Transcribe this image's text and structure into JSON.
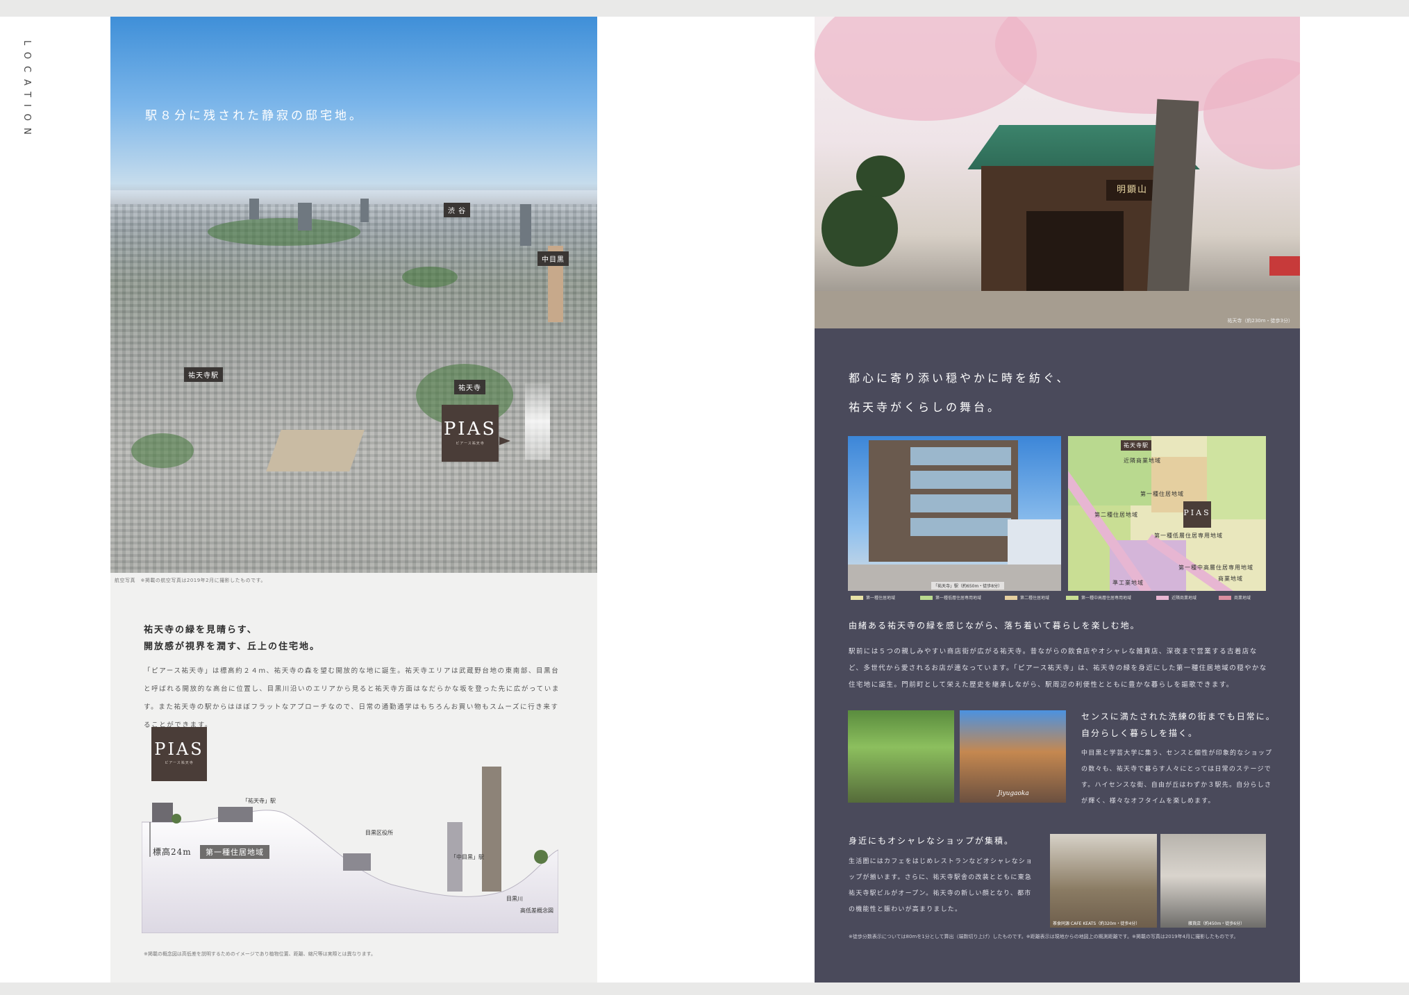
{
  "side_label": "LOCATION",
  "left": {
    "aerial_title": "駅８分に残された静寂の邸宅地。",
    "tags": {
      "shibuya": "渋 谷",
      "nakameguro": "中目黒",
      "yutenji_station": "祐天寺駅",
      "yutenji": "祐天寺"
    },
    "logo": "PIAS",
    "logo_sub": "ピアース祐天寺",
    "aerial_caption": "航空写真　※掲載の航空写真は2019年2月に撮影したものです。",
    "heading_line1": "祐天寺の緑を見晴らす、",
    "heading_line2": "開放感が視界を潤す、丘上の住宅地。",
    "body": "「ピアース祐天寺」は標高約２４ｍ、祐天寺の森を望む開放的な地に誕生。祐天寺エリアは武蔵野台地の東南部、目黒台と呼ばれる開放的な高台に位置し、目黒川沿いのエリアから見ると祐天寺方面はなだらかな坂を登った先に広がっています。また祐天寺の駅からはほぼフラットなアプローチなので、日常の通勤通学はもちろんお買い物もスムーズに行き来することができます。",
    "elev": {
      "station_label": "「祐天寺」駅",
      "ward_office": "目黒区役所",
      "nakameguro_label": "「中目黒」駅",
      "river": "目黒川",
      "museum": "高低差概念図",
      "height": "標高24m",
      "zone_badge": "第一種住居地域"
    },
    "note": "※掲載の概念図は高低差を説明するためのイメージであり植物位置、距離、縮尺等は実際とは異なります。"
  },
  "right": {
    "photo_caption": "祐天寺（約230m・徒歩3分）",
    "temple_sign": "明顕山",
    "heading_line1": "都心に寄り添い穏やかに時を紡ぐ、",
    "heading_line2": "祐天寺がくらしの舞台。",
    "station_caption": "「祐天寺」駅（約650m・徒歩8分）",
    "map_tags": {
      "station": "祐天寺駅",
      "z1": "近隣商業地域",
      "z2": "第一種住居地域",
      "z3": "第二種住居地域",
      "z4": "第一種低層住居専用地域",
      "z5": "第一種中高層住居専用地域",
      "z6": "商業地域",
      "z7": "準工業地域"
    },
    "legend": [
      {
        "label": "第一種住居地域",
        "color": "#e8e2a6"
      },
      {
        "label": "第一種低層住居専用地域",
        "color": "#b9d98f"
      },
      {
        "label": "第二種住居地域",
        "color": "#e5cfa0"
      },
      {
        "label": "第一種中高層住居専用地域",
        "color": "#c9de94"
      },
      {
        "label": "近隣商業地域",
        "color": "#e7b6d2"
      },
      {
        "label": "商業地域",
        "color": "#d98ea0"
      }
    ],
    "sub_heading": "由緒ある祐天寺の緑を感じながら、落ち着いて暮らしを楽しむ地。",
    "body": "駅前には５つの親しみやすい商店街が広がる祐天寺。昔ながらの飲食店やオシャレな雑貨店、深夜まで営業する古着店など、多世代から愛されるお店が連なっています。「ピアース祐天寺」は、祐天寺の緑を身近にした第一種住居地域の穏やかな住宅地に誕生。門前町として栄えた歴史を継承しながら、駅周辺の利便性とともに豊かな暮らしを謳歌できます。",
    "thumb_caption": "Jiyugaoka",
    "heading3_line1": "センスに満たされた洗練の街までも日常に。",
    "heading3_line2": "自分らしく暮らしを描く。",
    "body3": "中目黒と学芸大学に集う、センスと個性が印象的なショップの数々も、祐天寺で暮らす人々にとっては日常のステージです。ハイセンスな街、自由が丘はわずか３駅先。自分らしさが輝く、様々なオフタイムを楽しめます。",
    "heading4": "身近にもオシャレなショップが集積。",
    "body4": "生活圏にはカフェをはじめレストランなどオシャレなショップが揃います。さらに、祐天寺駅舎の改装とともに東急祐天寺駅ビルがオープン。祐天寺の新しい顔となり、都市の機能性と賑わいが高まりました。",
    "shop1_caption": "茶食同源 CAFE KEATS（約320m・徒歩4分）",
    "shop2_caption": "雑貨店（約450m・徒歩6分）",
    "note": "※徒歩分数表示については80mを1分として算出（端数切り上げ）したものです。※距離表示は現地からの地図上の概測距離です。※掲載の写真は2019年4月に撮影したものです。"
  }
}
